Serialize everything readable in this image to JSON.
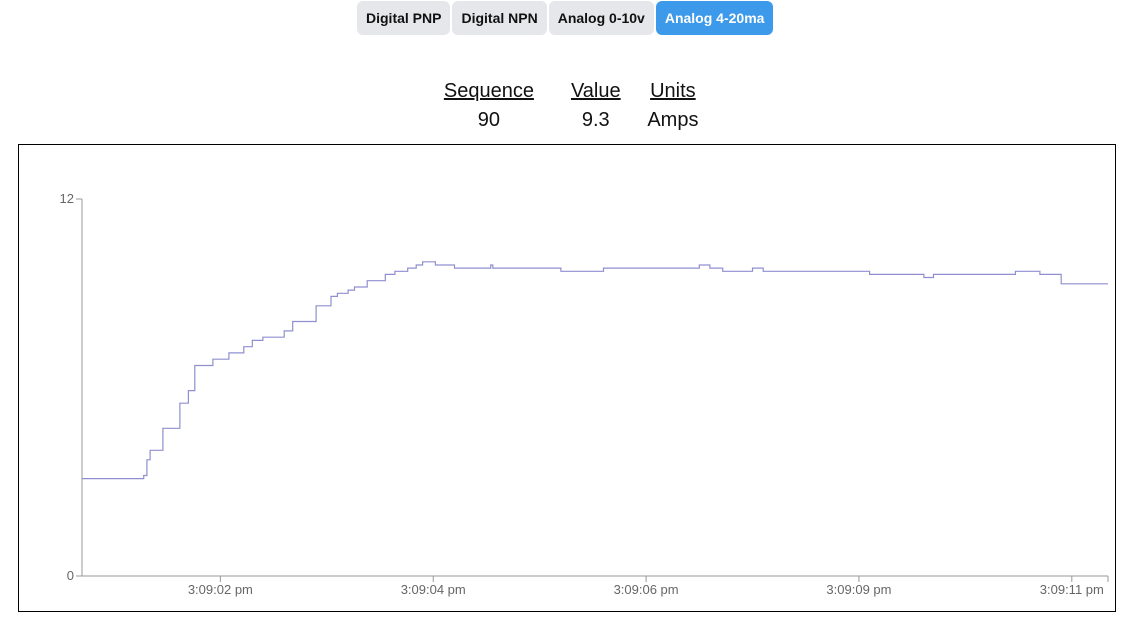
{
  "tabs": [
    {
      "label": "Digital PNP",
      "active": false
    },
    {
      "label": "Digital NPN",
      "active": false
    },
    {
      "label": "Analog 0-10v",
      "active": false
    },
    {
      "label": "Analog 4-20ma",
      "active": true
    }
  ],
  "readout": {
    "headers": {
      "sequence": "Sequence",
      "value": "Value",
      "units": "Units"
    },
    "values": {
      "sequence": "90",
      "value": "9.3",
      "units": "Amps"
    }
  },
  "colors": {
    "accent": "#3d99ea",
    "line": "#8f8fd0",
    "axis": "#999999"
  },
  "chart_data": {
    "type": "line",
    "step": true,
    "ylim": [
      0,
      12
    ],
    "y_ticks": [
      "0",
      "12"
    ],
    "xlim": [
      0,
      9.64
    ],
    "x_ticks": [
      {
        "x": 1.3,
        "label": "3:09:02 pm"
      },
      {
        "x": 3.3,
        "label": "3:09:04 pm"
      },
      {
        "x": 5.3,
        "label": "3:09:06 pm"
      },
      {
        "x": 7.3,
        "label": "3:09:09 pm"
      },
      {
        "x": 9.3,
        "label": "3:09:11 pm"
      }
    ],
    "series": [
      {
        "points": [
          [
            0,
            3.1
          ],
          [
            0.58,
            3.2
          ],
          [
            0.61,
            3.7
          ],
          [
            0.64,
            4.0
          ],
          [
            0.76,
            4.7
          ],
          [
            0.92,
            5.5
          ],
          [
            1.0,
            5.9
          ],
          [
            1.06,
            6.7
          ],
          [
            1.23,
            6.9
          ],
          [
            1.38,
            7.1
          ],
          [
            1.52,
            7.3
          ],
          [
            1.6,
            7.5
          ],
          [
            1.7,
            7.6
          ],
          [
            1.9,
            7.8
          ],
          [
            1.98,
            8.1
          ],
          [
            2.2,
            8.6
          ],
          [
            2.34,
            8.9
          ],
          [
            2.4,
            9.0
          ],
          [
            2.5,
            9.1
          ],
          [
            2.56,
            9.2
          ],
          [
            2.68,
            9.4
          ],
          [
            2.85,
            9.6
          ],
          [
            2.94,
            9.7
          ],
          [
            3.06,
            9.8
          ],
          [
            3.14,
            9.9
          ],
          [
            3.2,
            10.0
          ],
          [
            3.24,
            10.0
          ],
          [
            3.32,
            9.9
          ],
          [
            3.5,
            9.8
          ],
          [
            3.8,
            9.8
          ],
          [
            3.84,
            9.9
          ],
          [
            3.86,
            9.8
          ],
          [
            4.5,
            9.7
          ],
          [
            4.9,
            9.8
          ],
          [
            5.8,
            9.9
          ],
          [
            5.9,
            9.8
          ],
          [
            6.02,
            9.7
          ],
          [
            6.3,
            9.8
          ],
          [
            6.4,
            9.7
          ],
          [
            7.4,
            9.6
          ],
          [
            7.91,
            9.5
          ],
          [
            8.0,
            9.6
          ],
          [
            8.52,
            9.6
          ],
          [
            8.77,
            9.7
          ],
          [
            9.0,
            9.6
          ],
          [
            9.2,
            9.3
          ],
          [
            9.64,
            9.3
          ]
        ]
      }
    ]
  }
}
